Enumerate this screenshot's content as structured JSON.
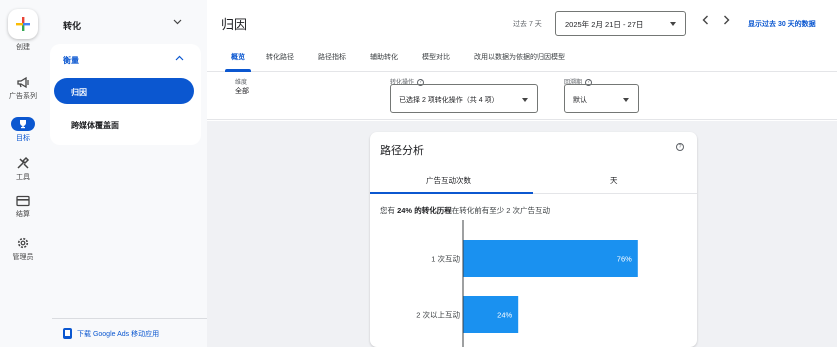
{
  "rail": {
    "items": [
      {
        "label": "创建",
        "icon": "plus-icon"
      },
      {
        "label": "广告系列",
        "icon": "megaphone-icon"
      },
      {
        "label": "目标",
        "icon": "trophy-icon"
      },
      {
        "label": "工具",
        "icon": "tools-icon"
      },
      {
        "label": "结算",
        "icon": "credit-card-icon"
      },
      {
        "label": "管理员",
        "icon": "gear-icon"
      }
    ],
    "active": "目标"
  },
  "subnav": {
    "header": "转化",
    "section": "衡量",
    "items": [
      "归因",
      "跨媒体覆盖面"
    ],
    "active_item": "归因",
    "mobile_link": "下载 Google Ads 移动应用"
  },
  "header": {
    "title": "归因",
    "range_label": "过去 7 天",
    "date_range": "2025年 2月 21日 - 27日",
    "show_past_link": "显示过去 30 天的数据"
  },
  "tabs": [
    "概览",
    "转化路径",
    "路径指标",
    "辅助转化",
    "模型对比",
    "改用以数据为依据的归因模型"
  ],
  "active_tab": "概览",
  "filters": {
    "dimension_label": "维度",
    "dimension_value": "全部",
    "conversion_label": "转化操作",
    "conversion_value": "已选择 2 项转化操作（共 4 项）",
    "lookback_label": "回溯期",
    "lookback_value": "默认"
  },
  "card": {
    "title": "路径分析",
    "tabs": [
      "广告互动次数",
      "天"
    ],
    "active_tab": "广告互动次数",
    "summary_pre": "您有",
    "summary_pct": "24%",
    "summary_bold": "的转化历程",
    "summary_post": "在转化前有至少 2 次广告互动"
  },
  "chart_data": {
    "type": "bar",
    "orientation": "horizontal",
    "categories": [
      "1 次互动",
      "2 次以上互动"
    ],
    "values": [
      76,
      24
    ],
    "value_labels": [
      "76%",
      "24%"
    ],
    "xlim": [
      0,
      100
    ],
    "bar_color": "#1a91f0"
  },
  "colors": {
    "accent": "#0b57d0",
    "bar": "#1a91f0"
  }
}
